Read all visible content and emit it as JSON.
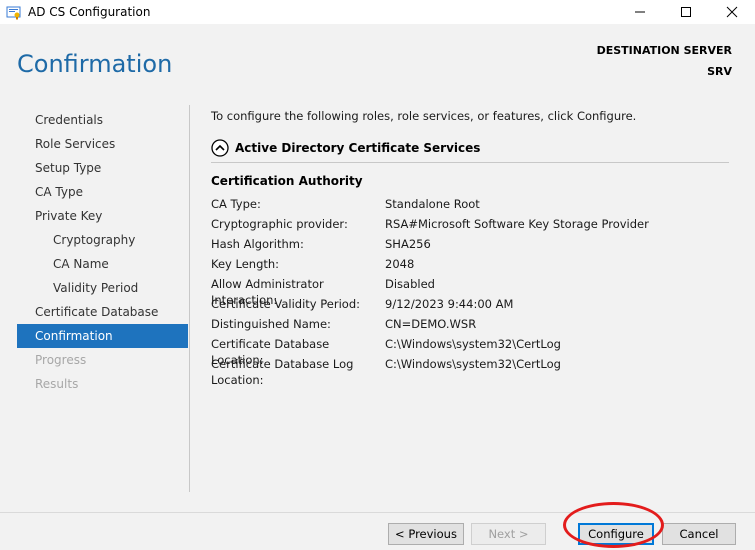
{
  "window": {
    "title": "AD CS Configuration"
  },
  "header": {
    "page_title": "Confirmation",
    "destination_label": "DESTINATION SERVER",
    "destination_server": "SRV"
  },
  "nav": {
    "items": [
      {
        "label": "Credentials",
        "state": "normal"
      },
      {
        "label": "Role Services",
        "state": "normal"
      },
      {
        "label": "Setup Type",
        "state": "normal"
      },
      {
        "label": "CA Type",
        "state": "normal"
      },
      {
        "label": "Private Key",
        "state": "normal"
      },
      {
        "label": "Cryptography",
        "state": "sub"
      },
      {
        "label": "CA Name",
        "state": "sub"
      },
      {
        "label": "Validity Period",
        "state": "sub"
      },
      {
        "label": "Certificate Database",
        "state": "normal"
      },
      {
        "label": "Confirmation",
        "state": "active"
      },
      {
        "label": "Progress",
        "state": "disabled"
      },
      {
        "label": "Results",
        "state": "disabled"
      }
    ]
  },
  "content": {
    "intro": "To configure the following roles, role services, or features, click Configure.",
    "section_title": "Active Directory Certificate Services",
    "group_title": "Certification Authority",
    "properties": [
      {
        "label": "CA Type:",
        "value": "Standalone Root"
      },
      {
        "label": "Cryptographic provider:",
        "value": "RSA#Microsoft Software Key Storage Provider"
      },
      {
        "label": "Hash Algorithm:",
        "value": "SHA256"
      },
      {
        "label": "Key Length:",
        "value": "2048"
      },
      {
        "label": "Allow Administrator Interaction:",
        "value": "Disabled"
      },
      {
        "label": "Certificate Validity Period:",
        "value": "9/12/2023 9:44:00 AM"
      },
      {
        "label": "Distinguished Name:",
        "value": "CN=DEMO.WSR"
      },
      {
        "label": "Certificate Database Location:",
        "value": "C:\\Windows\\system32\\CertLog"
      },
      {
        "label": "Certificate Database Log Location:",
        "value": "C:\\Windows\\system32\\CertLog"
      }
    ]
  },
  "footer": {
    "previous_label": "< Previous",
    "next_label": "Next >",
    "configure_label": "Configure",
    "cancel_label": "Cancel"
  },
  "icons": {
    "app": "certificate-app-icon",
    "minimize": "minimize-icon",
    "maximize": "maximize-icon",
    "close": "close-icon",
    "collapse": "chevron-up-circle-icon"
  },
  "colors": {
    "title_blue": "#1e6aa7",
    "nav_active": "#1e73be",
    "annotation_red": "#e31c1c"
  }
}
